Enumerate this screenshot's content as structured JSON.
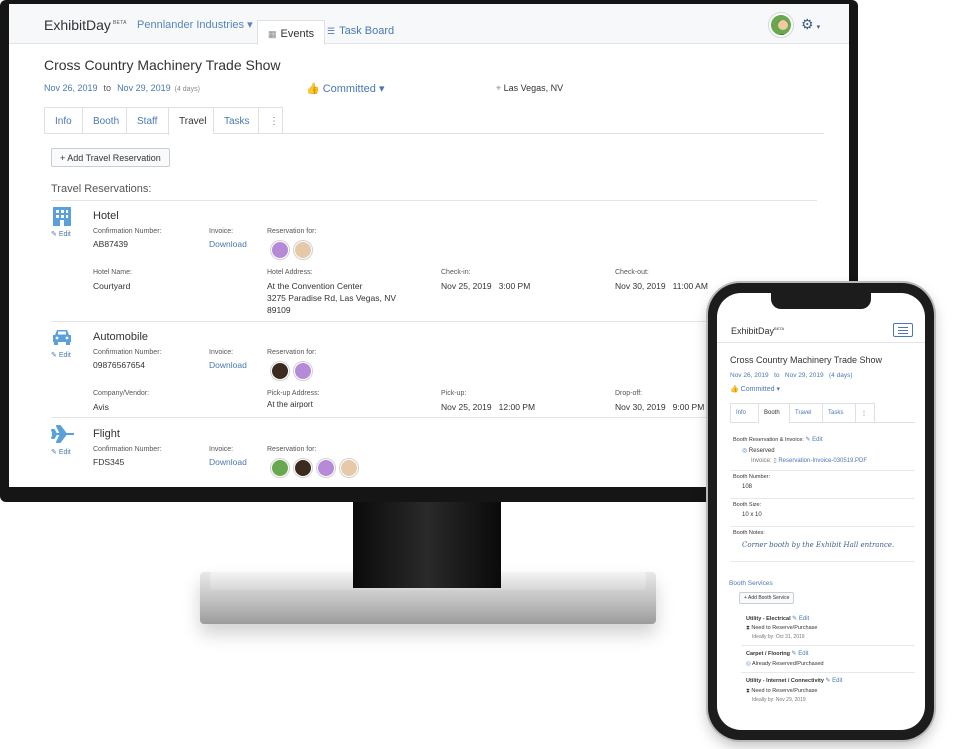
{
  "app": {
    "logo": "ExhibitDay",
    "logo_badge": "BETA",
    "org": "Pennlander Industries ▾",
    "nav_events": "Events",
    "nav_taskboard": "Task Board"
  },
  "event": {
    "title": "Cross Country Machinery Trade Show",
    "start": "Nov 26, 2019",
    "to": "to",
    "end": "Nov 29, 2019",
    "duration": "(4 days)",
    "status": "Committed ▾",
    "location": "Las Vegas, NV"
  },
  "tabs": [
    "Info",
    "Booth",
    "Staff",
    "Travel",
    "Tasks",
    "⋮"
  ],
  "travel": {
    "add_button": "+ Add Travel Reservation",
    "heading": "Travel Reservations:",
    "edit": "Edit",
    "labels": {
      "confirmation": "Confirmation Number:",
      "invoice": "Invoice:",
      "res_for": "Reservation for:",
      "download": "Download"
    },
    "hotel": {
      "type": "Hotel",
      "confirmation": "AB87439",
      "name_label": "Hotel Name:",
      "name": "Courtyard",
      "addr_label": "Hotel Address:",
      "addr1": "At the Convention Center",
      "addr2": "3275 Paradise Rd, Las Vegas, NV",
      "addr3": "89109",
      "checkin_label": "Check-in:",
      "checkin": "Nov 25, 2019   3:00 PM",
      "checkout_label": "Check-out:",
      "checkout": "Nov 30, 2019   11:00 AM"
    },
    "auto": {
      "type": "Automobile",
      "confirmation": "09876567654",
      "vendor_label": "Company/Vendor:",
      "vendor": "Avis",
      "pickup_addr_label": "Pick-up Address:",
      "pickup_addr": "At the airport",
      "pickup_label": "Pick-up:",
      "pickup": "Nov 25, 2019   12:00 PM",
      "dropoff_label": "Drop-off:",
      "dropoff": "Nov 30, 2019   9:00 PM"
    },
    "flight": {
      "type": "Flight",
      "confirmation": "FDS345"
    }
  },
  "mobile": {
    "logo": "ExhibitDay",
    "logo_badge": "BETA",
    "title": "Cross Country Machinery Trade Show",
    "dates": "Nov 26, 2019   to   Nov 29, 2019   (4 days)",
    "status": "Committed ▾",
    "tabs": [
      "Info",
      "Booth",
      "Travel",
      "Tasks",
      "⋮"
    ],
    "booth_res_label": "Booth Reservation & Invoice:",
    "edit": "Edit",
    "reserved": "Reserved",
    "invoice_label": "Invoice:",
    "invoice_file": "Reservation-Invoice-030519.PDF",
    "booth_number_label": "Booth Number:",
    "booth_number": "108",
    "booth_size_label": "Booth Size:",
    "booth_size": "10 x 10",
    "booth_notes_label": "Booth Notes:",
    "booth_notes": "Corner booth by the Exhibit Hall entrance.",
    "services_heading": "Booth Services",
    "add_service": "+ Add Booth Service",
    "services": [
      {
        "name": "Utility - Electrical",
        "status": "Need to Reserve/Purchase",
        "by": "Ideally by: Oct 31, 2019"
      },
      {
        "name": "Carpet / Flooring",
        "status": "Already Reserved/Purchased",
        "by": ""
      },
      {
        "name": "Utility - Internet / Connectivity",
        "status": "Need to Reserve/Purchase",
        "by": "Ideally by: Nov 29, 2019"
      }
    ]
  },
  "colors": {
    "accent": "#4a78b5",
    "icon": "#5aa0db",
    "frame": "#151515"
  }
}
